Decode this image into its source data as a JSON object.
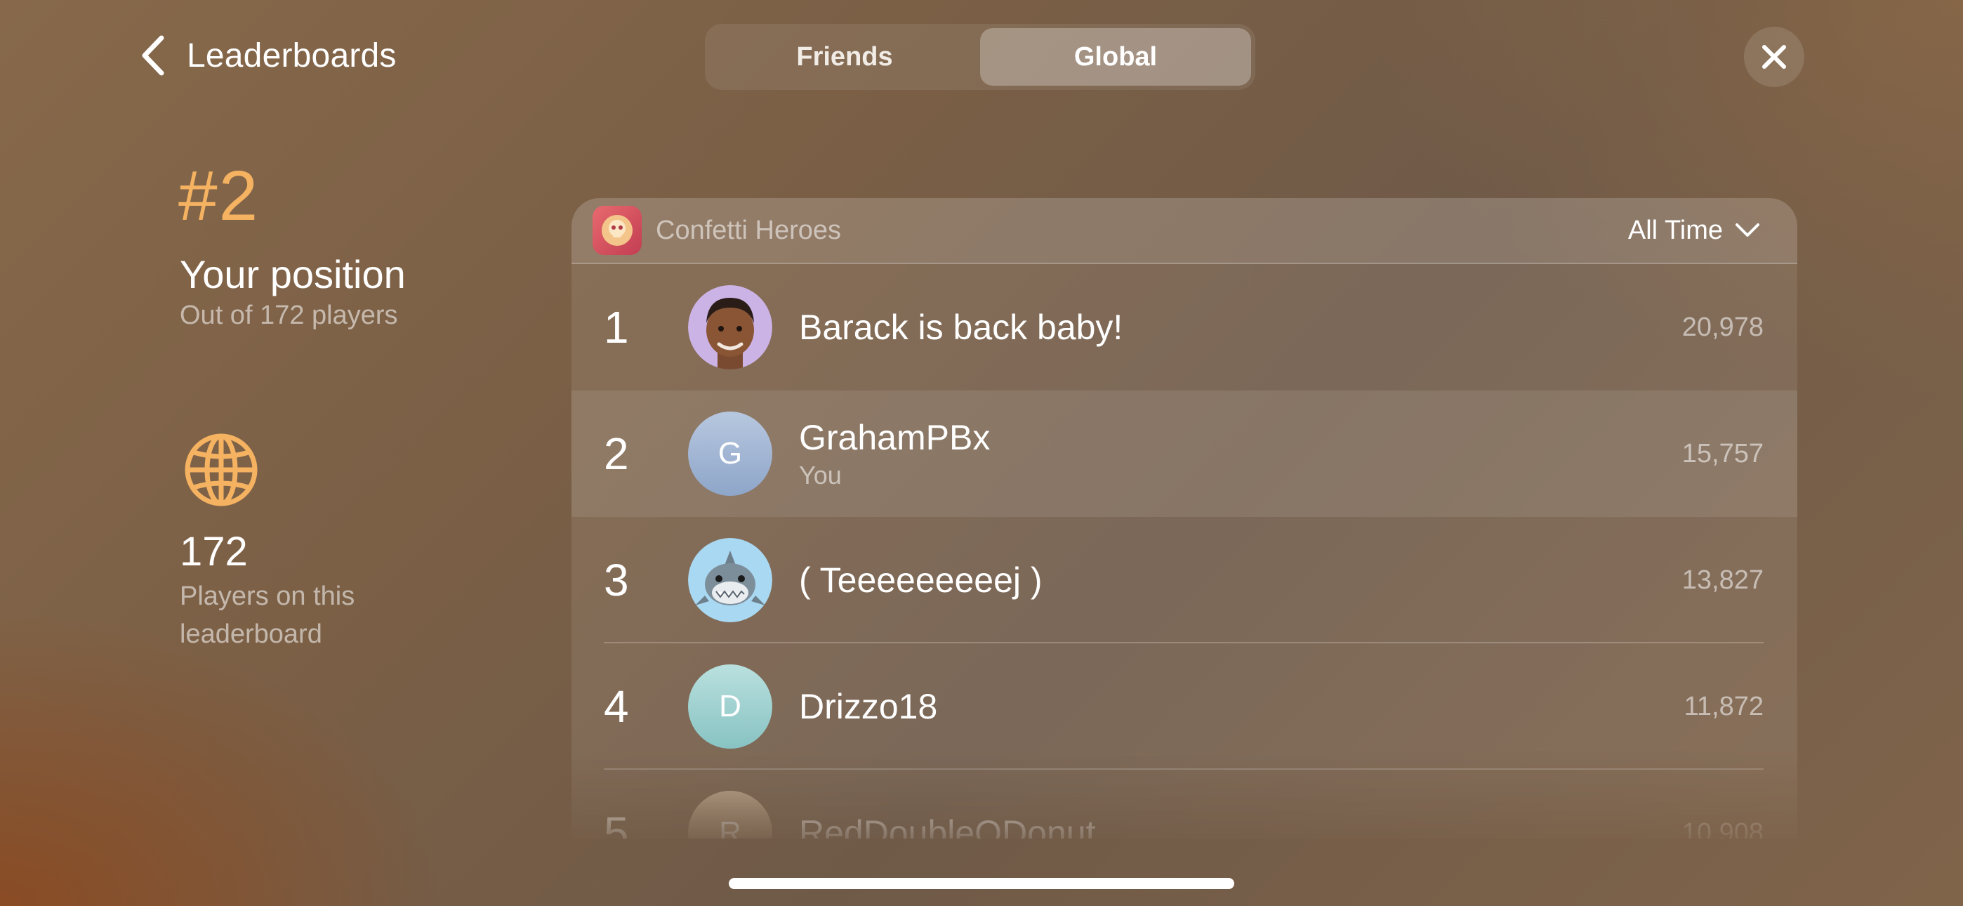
{
  "header": {
    "back_label": "Leaderboards",
    "tabs": [
      {
        "label": "Friends",
        "active": false
      },
      {
        "label": "Global",
        "active": true
      }
    ],
    "close_icon": "close-icon"
  },
  "summary": {
    "rank": "#2",
    "position_title": "Your position",
    "position_sub": "Out of 172 players",
    "players_count": "172",
    "players_label": "Players on this leaderboard",
    "accent_color": "#f5b261"
  },
  "leaderboard": {
    "game_name": "Confetti Heroes",
    "time_filter": "All Time",
    "rows": [
      {
        "rank": "1",
        "name": "Barack is back baby!",
        "sub": "",
        "score": "20,978",
        "avatar": "memoji"
      },
      {
        "rank": "2",
        "name": "GrahamPBx",
        "sub": "You",
        "score": "15,757",
        "avatar": "G"
      },
      {
        "rank": "3",
        "name": "( Teeeeeeeeej )",
        "sub": "",
        "score": "13,827",
        "avatar": "shark"
      },
      {
        "rank": "4",
        "name": "Drizzo18",
        "sub": "",
        "score": "11,872",
        "avatar": "D"
      },
      {
        "rank": "5",
        "name": "RedDoubleODonut",
        "sub": "",
        "score": "10,908",
        "avatar": "R"
      }
    ]
  }
}
